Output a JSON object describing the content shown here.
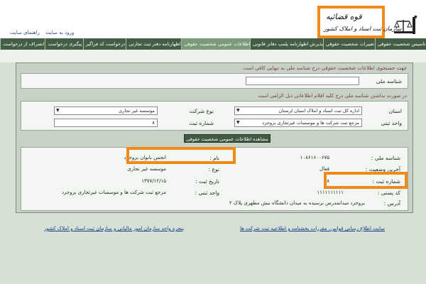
{
  "logo": {
    "line1": "قوه قضائیه",
    "line2": "سازمان ثبت اسناد و املاک کشور"
  },
  "top_links": [
    "ورود به سایت",
    "راهنمای سایت"
  ],
  "nav": [
    "تاسیس شخصیت حقوقی",
    "تغییرات شخصیت حقوقی",
    "پذیرش اظهارنامه پلمپ دفاتر قانونی",
    "اطلاعات عمومی شخصیت حقوقی",
    "اظهارنامه دفتر ثبت تجارتی",
    "درخواست کد فراگیر",
    "پیگیری درخواست",
    "انصراف از درخواست"
  ],
  "search": {
    "header": "جهت جستجوی اطلاعات شخصیت حقوقی درج شناسه ملی به تنهایی کافی است",
    "national_id_label": "شناسه ملی",
    "national_id_value": "",
    "alt_header": "در صورت نداشتن شناسه ملی درج کلیه اقلام اطلاعاتی ذیل الزامی است",
    "province_label": "استان",
    "province_value": "اداره کل ثبت اسناد و املاک استان لرستان",
    "unit_label": "واحد ثبتی",
    "unit_value": "مرجع ثبت شرکت ها و موسسات غیرتجاری بروجرد",
    "company_type_label": "نوع شرکت",
    "company_type_value": "موسسه غیر تجاری",
    "reg_no_label": "شماره ثبت",
    "reg_no_value": "۸",
    "button": "مشاهده اطلاعات عمومی شخصیت حقوقی"
  },
  "result": {
    "national_id_label": "شناسه ملی :",
    "national_id_value": "۱۰۸۶۱۶۰۰۶۷۵",
    "name_label": "نام :",
    "name_value": "انجمن بانوان بروجرد",
    "status_label": "آخرین وضعیت :",
    "status_value": "فعال",
    "type_label": "نوع :",
    "type_value": "موسسه غیر تجاری",
    "reg_no_label": "شماره ثبت :",
    "reg_no_value": "۸",
    "reg_date_label": "تاریخ ثبت :",
    "reg_date_value": "۱۳۷۷/۱۲/۱۵",
    "postal_label": "کد پستی :",
    "postal_value": "۱۱۱۱۱۱۱۱۱۱",
    "unit_label": "واحد ثبتی :",
    "unit_value": "مرجع ثبت شرکت ها و موسسات غیرتجاری بروجرد",
    "address_label": "آدرس :",
    "address_value": "بروجرد میدانمدرس نرسیده به میدان دانشگاه نبش مطهری پلاک ۲"
  },
  "footer": {
    "link_right": "سایت اطلاع رسانی قوانین، مقررات بخشنامه و اطلاعیه ثبت شرکت ها",
    "link_left": "پنجره واحد سازمان امور مالیاتی و سازمان ثبت اسناد و املاک کشور"
  },
  "colors": {
    "nav_bg": "#445e46",
    "highlight": "#f28a1a",
    "panel_bg": "#c7d1c6"
  }
}
